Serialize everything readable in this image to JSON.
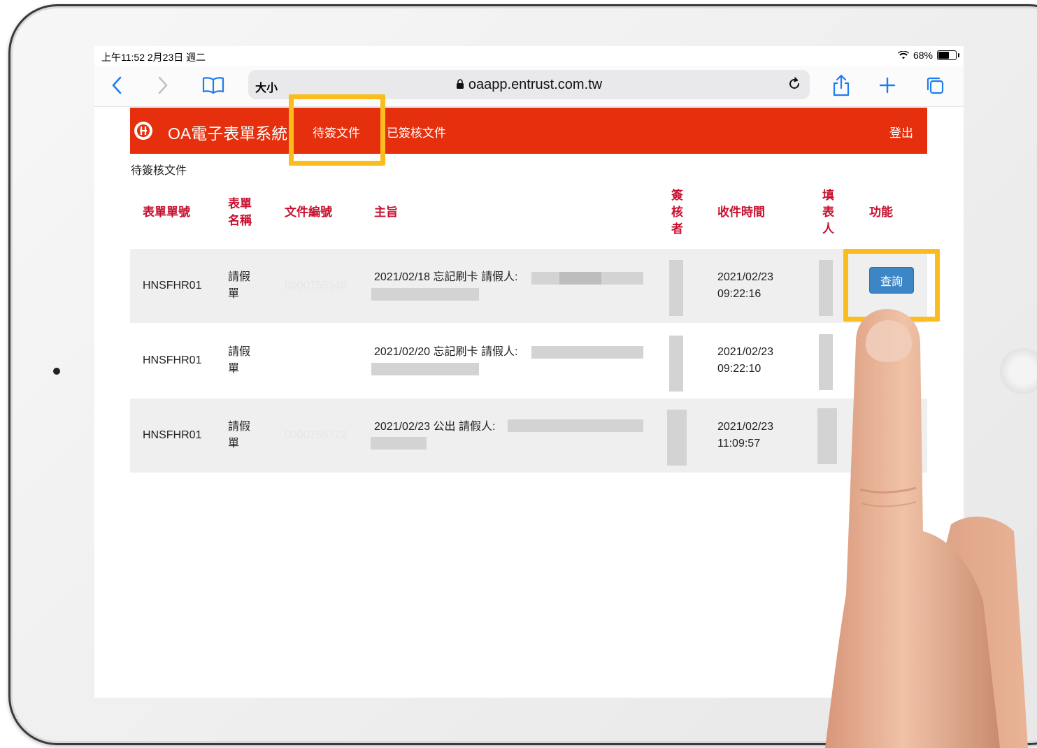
{
  "status_bar": {
    "time_date": "上午11:52  2月23日 週二",
    "battery": "68%",
    "battery_level": 0.68
  },
  "browser": {
    "text_size_label": "大小",
    "url": "oaapp.entrust.com.tw",
    "icons": [
      "back-icon",
      "forward-icon",
      "bookmarks-icon",
      "reload-icon",
      "share-icon",
      "new-tab-icon",
      "tabs-icon"
    ]
  },
  "app": {
    "brand": "OA電子表單系統",
    "tabs": [
      "待簽文件",
      "已簽核文件"
    ],
    "logout": "登出",
    "section_title": "待簽核文件",
    "accent_color": "#e52f0d",
    "header_text_color": "#c8102e"
  },
  "table": {
    "headers": {
      "form_no": "表單單號",
      "form_name": "表單名稱",
      "doc_no": "文件編號",
      "subject": "主旨",
      "approver": "簽核者",
      "received": "收件時間",
      "filler": "填表人",
      "action": "功能"
    },
    "rows": [
      {
        "form_no": "HNSFHR01",
        "form_name": "請假單",
        "doc_no": "0000756340",
        "subject": "2021/02/18 忘記刷卡 請假人:",
        "received_date": "2021/02/23",
        "received_time": "09:22:16",
        "action": "查詢"
      },
      {
        "form_no": "HNSFHR01",
        "form_name": "請假單",
        "doc_no": "",
        "subject": "2021/02/20 忘記刷卡 請假人:",
        "received_date": "2021/02/23",
        "received_time": "09:22:10"
      },
      {
        "form_no": "HNSFHR01",
        "form_name": "請假單",
        "doc_no": "0000756773",
        "subject": "2021/02/23 公出 請假人:",
        "received_date": "2021/02/23",
        "received_time": "11:09:57"
      }
    ]
  },
  "highlight_color": "#fbbd1d"
}
